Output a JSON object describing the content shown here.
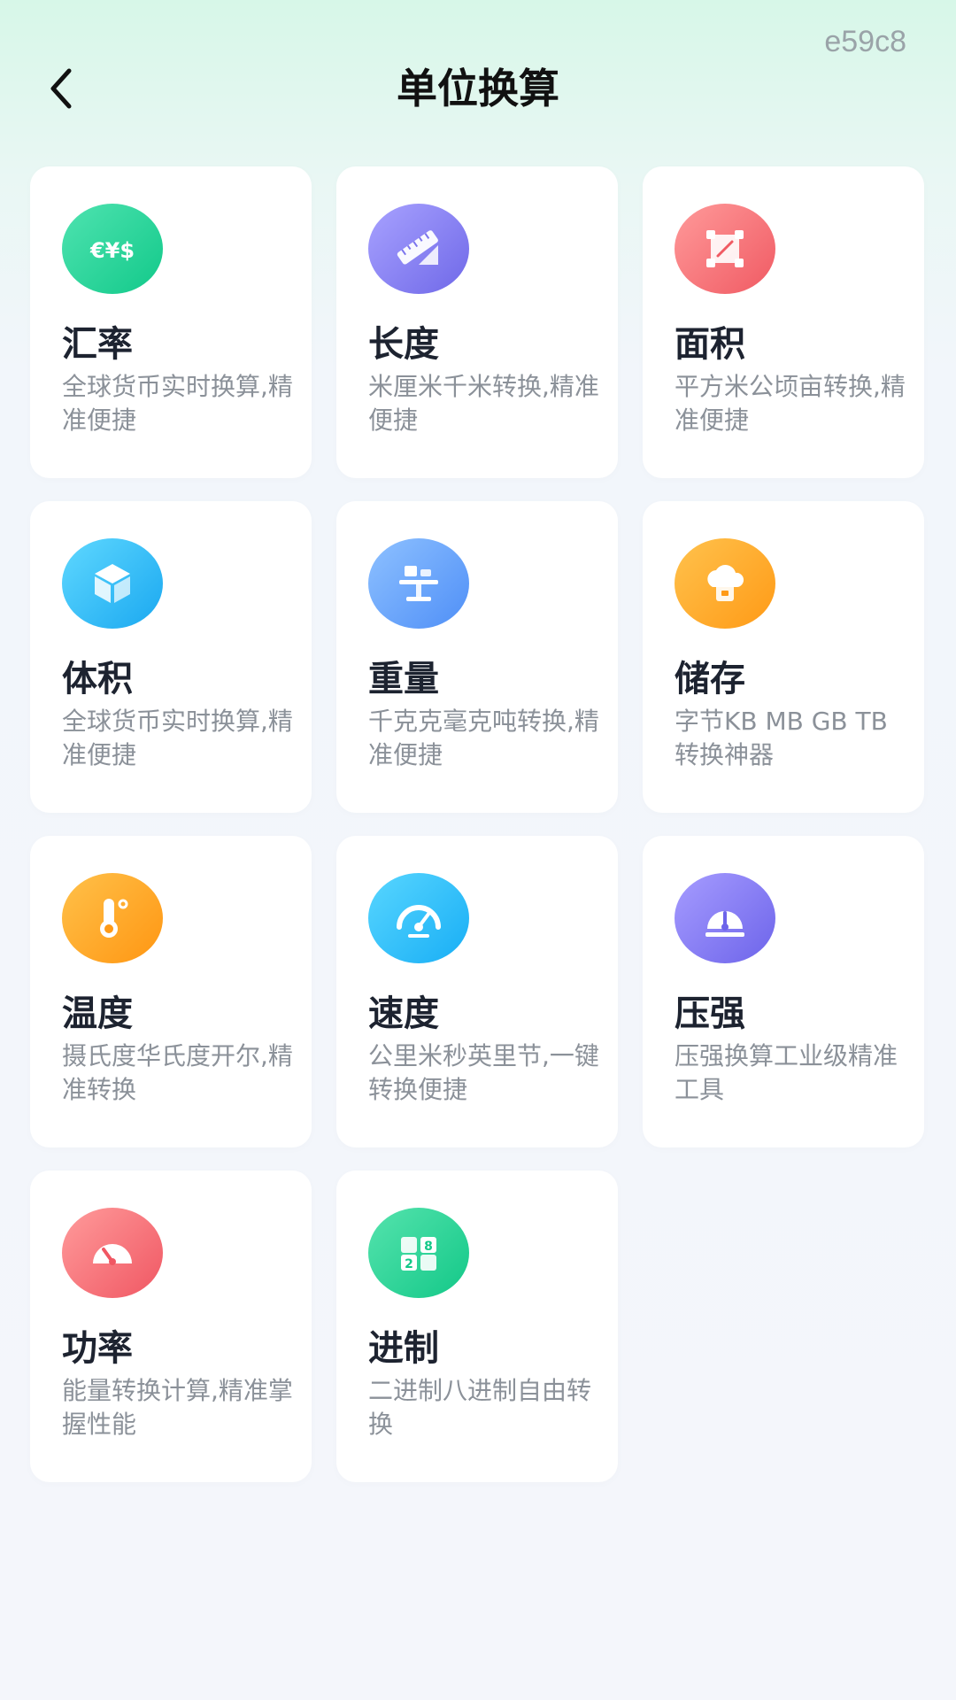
{
  "watermark": "e59c8",
  "header": {
    "title": "单位换算",
    "back_icon": "chevron-left-icon"
  },
  "cards": [
    {
      "title": "汇率",
      "desc": "全球货币实时换算,精准便捷",
      "icon": "currency-icon",
      "color_from": "#4fe3b0",
      "color_to": "#12c98a"
    },
    {
      "title": "长度",
      "desc": "米厘米千米转换,精准便捷",
      "icon": "ruler-icon",
      "color_from": "#a8a2ff",
      "color_to": "#6f68e8"
    },
    {
      "title": "面积",
      "desc": "平方米公顷亩转换,精准便捷",
      "icon": "area-icon",
      "color_from": "#ff9a9a",
      "color_to": "#f05a63"
    },
    {
      "title": "体积",
      "desc": "全球货币实时换算,精准便捷",
      "icon": "cube-icon",
      "color_from": "#5fd8ff",
      "color_to": "#1aa8f0"
    },
    {
      "title": "重量",
      "desc": "千克克毫克吨转换,精准便捷",
      "icon": "scale-icon",
      "color_from": "#8ec1ff",
      "color_to": "#4f8ff7"
    },
    {
      "title": "储存",
      "desc": "字节KB MB GB TB转换神器",
      "icon": "cloud-storage-icon",
      "color_from": "#ffc24d",
      "color_to": "#ff9a16"
    },
    {
      "title": "温度",
      "desc": "摄氏度华氏度开尔,精准转换",
      "icon": "thermometer-icon",
      "color_from": "#ffc14a",
      "color_to": "#ff9612"
    },
    {
      "title": "速度",
      "desc": "公里米秒英里节,一键转换便捷",
      "icon": "speedometer-icon",
      "color_from": "#58d6ff",
      "color_to": "#18aef5"
    },
    {
      "title": "压强",
      "desc": "压强换算工业级精准工具",
      "icon": "gauge-icon",
      "color_from": "#a69cff",
      "color_to": "#6d64ea"
    },
    {
      "title": "功率",
      "desc": "能量转换计算,精准掌握性能",
      "icon": "power-meter-icon",
      "color_from": "#ff9b9b",
      "color_to": "#f05763"
    },
    {
      "title": "进制",
      "desc": "二进制八进制自由转换",
      "icon": "number-convert-icon",
      "color_from": "#55e3ad",
      "color_to": "#13c888"
    }
  ]
}
